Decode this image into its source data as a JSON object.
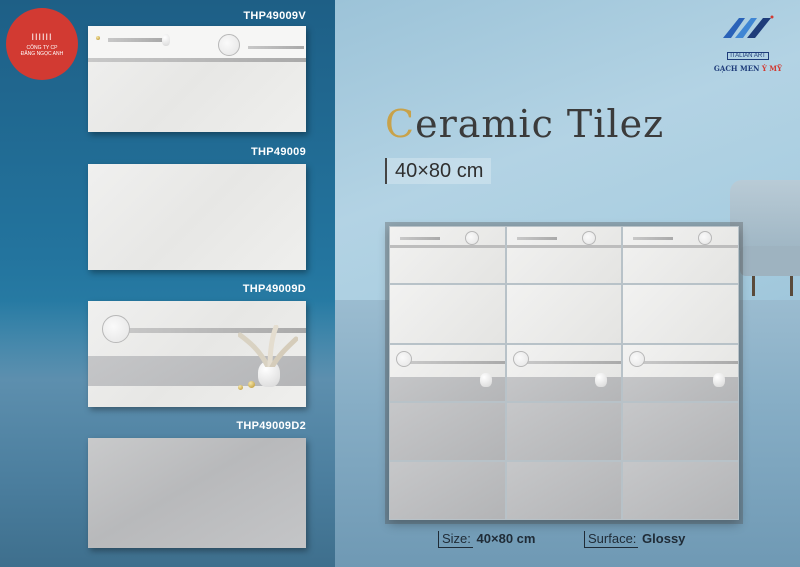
{
  "brand_left": {
    "bars": "IIIIII",
    "line1": "CÔNG TY CP",
    "line2": "ĐĂNG NGỌC ANH",
    "color": "#d23a32"
  },
  "brand_right": {
    "sub": "ITALIAN ART",
    "name_a": "GẠCH MEN",
    "name_b": "Ý MỸ",
    "color": "#1e3c7a"
  },
  "tiles": [
    {
      "code": "THP49009V"
    },
    {
      "code": "THP49009"
    },
    {
      "code": "THP49009D"
    },
    {
      "code": "THP49009D2"
    }
  ],
  "title": {
    "first": "C",
    "rest": "eramic Tilez"
  },
  "size_badge": "40×80 cm",
  "specs": {
    "size_label": "Size:",
    "size_value": "40×80 cm",
    "surface_label": "Surface:",
    "surface_value": "Glossy"
  },
  "colors": {
    "wall_dark": "#1e5f86",
    "wall_light": "#a8cde0",
    "accent_gold": "#c8a24a"
  }
}
